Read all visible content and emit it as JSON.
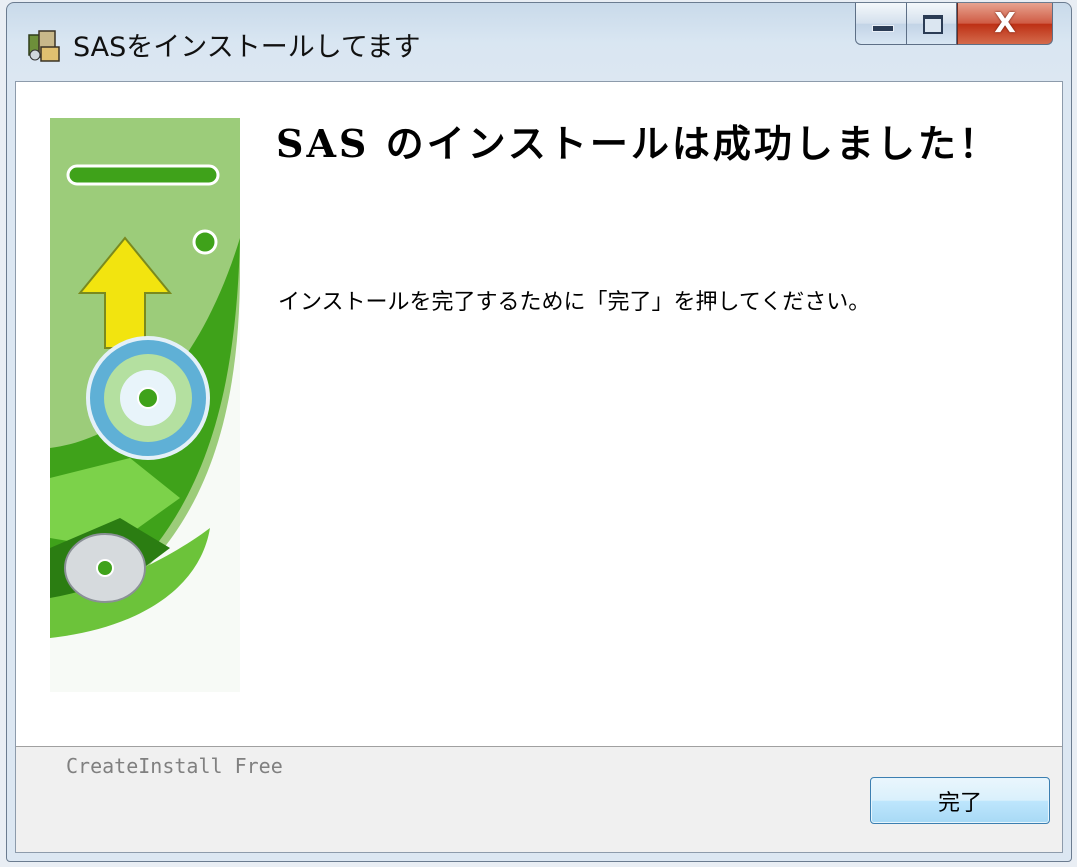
{
  "window": {
    "title": "SASをインストールしてます",
    "close_glyph": "X"
  },
  "content": {
    "heading": "SAS のインストールは成功しました！",
    "message": "インストールを完了するために「完了」を押してください。"
  },
  "footer": {
    "brand": "CreateInstall Free",
    "finish_label": "完了"
  },
  "colors": {
    "accent_green": "#3fa21a",
    "arrow_yellow": "#f2e40f",
    "close_red": "#c8462c",
    "button_border": "#3c7fb1"
  }
}
